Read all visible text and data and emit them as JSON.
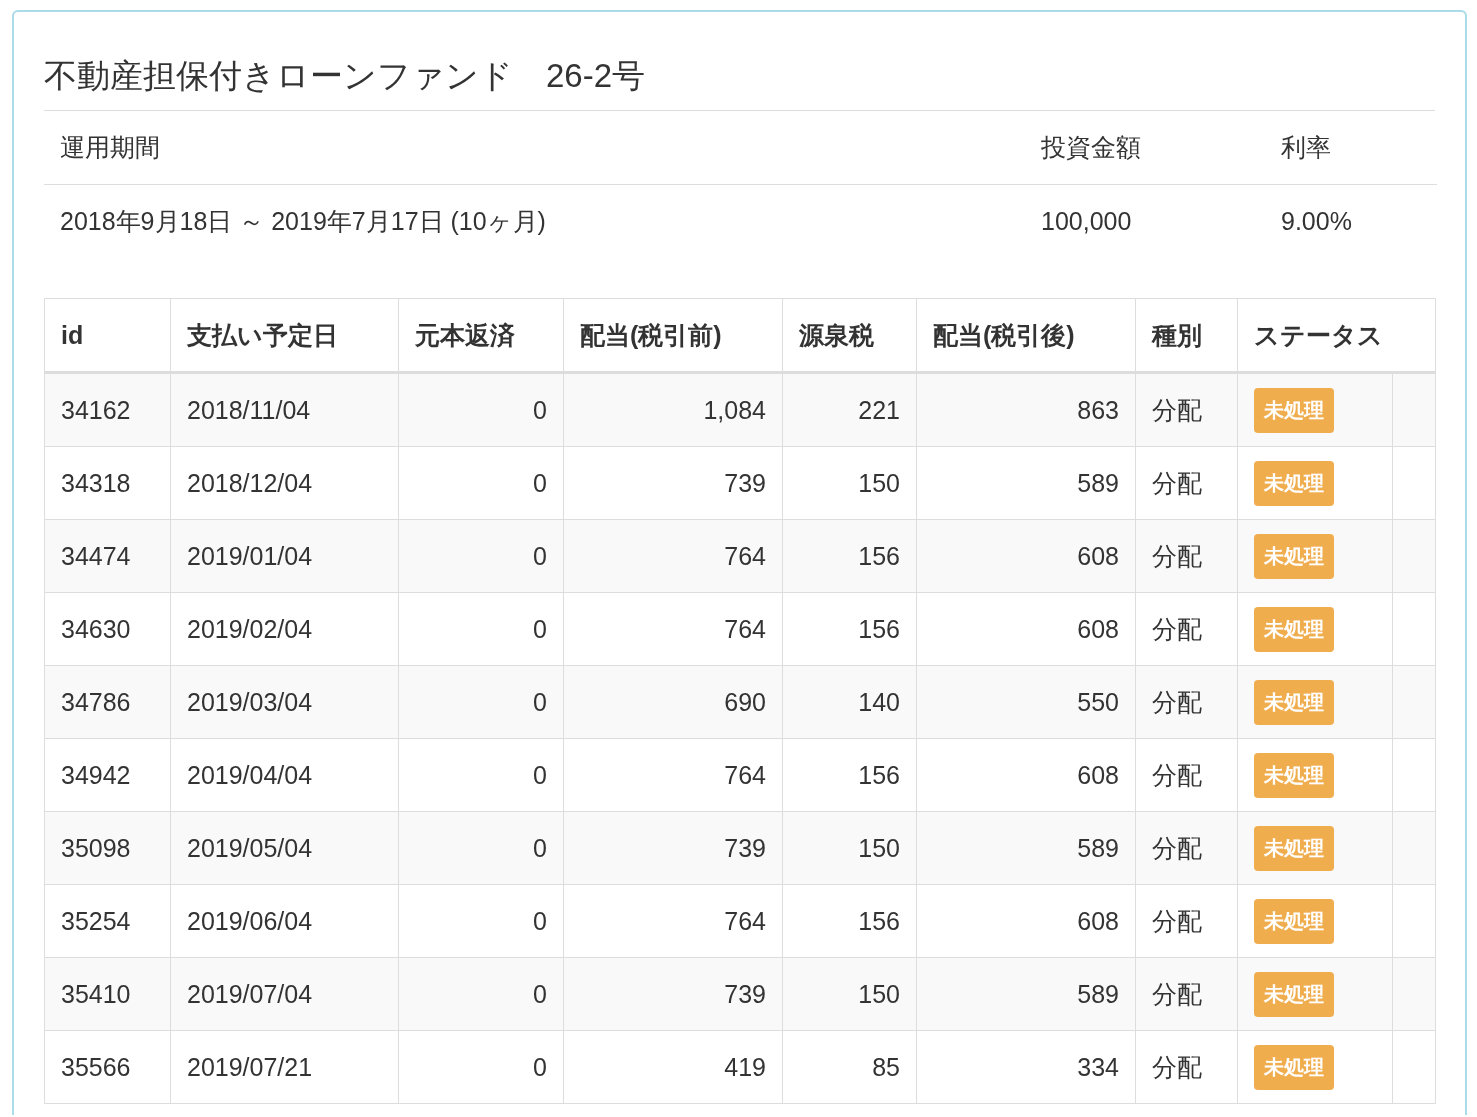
{
  "title": "不動産担保付きローンファンド　26-2号",
  "summary": {
    "columns": [
      "運用期間",
      "投資金額",
      "利率"
    ],
    "values": [
      "2018年9月18日 ～ 2019年7月17日 (10ヶ月)",
      "100,000",
      "9.00%"
    ]
  },
  "table": {
    "columns": [
      "id",
      "支払い予定日",
      "元本返済",
      "配当(税引前)",
      "源泉税",
      "配当(税引後)",
      "種別",
      "ステータス"
    ],
    "rows": [
      {
        "id": "34162",
        "date": "2018/11/04",
        "principal": "0",
        "pre_tax": "1,084",
        "tax": "221",
        "after_tax": "863",
        "type": "分配",
        "status": "未処理"
      },
      {
        "id": "34318",
        "date": "2018/12/04",
        "principal": "0",
        "pre_tax": "739",
        "tax": "150",
        "after_tax": "589",
        "type": "分配",
        "status": "未処理"
      },
      {
        "id": "34474",
        "date": "2019/01/04",
        "principal": "0",
        "pre_tax": "764",
        "tax": "156",
        "after_tax": "608",
        "type": "分配",
        "status": "未処理"
      },
      {
        "id": "34630",
        "date": "2019/02/04",
        "principal": "0",
        "pre_tax": "764",
        "tax": "156",
        "after_tax": "608",
        "type": "分配",
        "status": "未処理"
      },
      {
        "id": "34786",
        "date": "2019/03/04",
        "principal": "0",
        "pre_tax": "690",
        "tax": "140",
        "after_tax": "550",
        "type": "分配",
        "status": "未処理"
      },
      {
        "id": "34942",
        "date": "2019/04/04",
        "principal": "0",
        "pre_tax": "764",
        "tax": "156",
        "after_tax": "608",
        "type": "分配",
        "status": "未処理"
      },
      {
        "id": "35098",
        "date": "2019/05/04",
        "principal": "0",
        "pre_tax": "739",
        "tax": "150",
        "after_tax": "589",
        "type": "分配",
        "status": "未処理"
      },
      {
        "id": "35254",
        "date": "2019/06/04",
        "principal": "0",
        "pre_tax": "764",
        "tax": "156",
        "after_tax": "608",
        "type": "分配",
        "status": "未処理"
      },
      {
        "id": "35410",
        "date": "2019/07/04",
        "principal": "0",
        "pre_tax": "739",
        "tax": "150",
        "after_tax": "589",
        "type": "分配",
        "status": "未処理"
      },
      {
        "id": "35566",
        "date": "2019/07/21",
        "principal": "0",
        "pre_tax": "419",
        "tax": "85",
        "after_tax": "334",
        "type": "分配",
        "status": "未処理"
      }
    ]
  }
}
